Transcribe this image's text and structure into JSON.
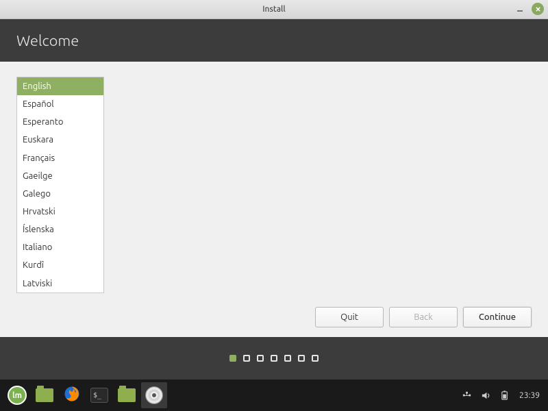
{
  "window": {
    "title": "Install"
  },
  "header": {
    "title": "Welcome"
  },
  "languages": {
    "items": [
      "English",
      "Español",
      "Esperanto",
      "Euskara",
      "Français",
      "Gaeilge",
      "Galego",
      "Hrvatski",
      "Íslenska",
      "Italiano",
      "Kurdî",
      "Latviski"
    ],
    "selected_index": 0
  },
  "buttons": {
    "quit": "Quit",
    "back": "Back",
    "continue": "Continue"
  },
  "progress": {
    "total": 7,
    "current": 0
  },
  "taskbar": {
    "clock": "23:39"
  },
  "colors": {
    "accent": "#8faf63",
    "header_bg": "#3c3c3c"
  }
}
